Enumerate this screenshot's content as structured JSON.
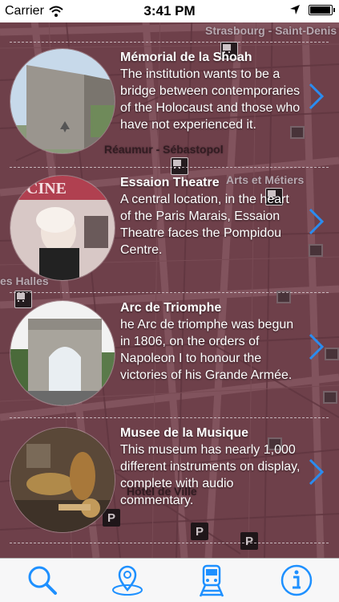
{
  "status_bar": {
    "carrier": "Carrier",
    "time": "3:41 PM",
    "battery_level": 0.95
  },
  "map": {
    "labels": [
      "Strasbourg - Saint-Denis",
      "Réaumur - Sébastopol",
      "Arts et Métiers",
      "es Halles",
      "Hôtel de Ville"
    ]
  },
  "places": [
    {
      "title": "Mémorial de la Shoah",
      "description": "The institution wants to be a bridge between contemporaries of the Holocaust and those who have not experienced it.",
      "image": "memorial-photo"
    },
    {
      "title": "Essaion Theatre",
      "description": "A central location, in the heart of the Paris Marais, Essaion Theatre faces the Pompidou Centre.",
      "image": "theatre-poster-photo"
    },
    {
      "title": "Arc de Triomphe",
      "description": "he Arc de triomphe was begun in 1806, on the orders of Napoleon I to honour the victories of his Grande Armée.",
      "image": "arc-de-triomphe-photo"
    },
    {
      "title": "Musee de la Musique",
      "description": "This museum has nearly 1,000 different instruments on display, complete with audio commentary.",
      "image": "music-instruments-photo"
    }
  ],
  "tabs": [
    {
      "name": "search",
      "icon": "magnifier-icon"
    },
    {
      "name": "map",
      "icon": "location-pin-icon"
    },
    {
      "name": "transport",
      "icon": "train-icon",
      "selected": true
    },
    {
      "name": "info",
      "icon": "info-icon"
    }
  ],
  "colors": {
    "accent": "#1e90ff",
    "tab_bg": "#f7f7f8",
    "map_base": "#7a4a52"
  }
}
